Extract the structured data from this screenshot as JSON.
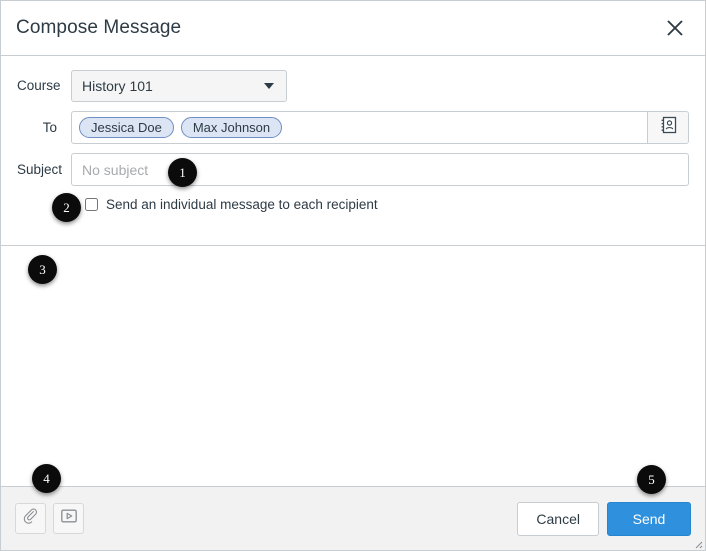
{
  "dialog": {
    "title": "Compose Message",
    "close_icon": "close-icon"
  },
  "form": {
    "course": {
      "label": "Course",
      "selected": "History 101",
      "caret_icon": "chevron-down-icon"
    },
    "to": {
      "label": "To",
      "recipients": [
        "Jessica Doe",
        "Max Johnson"
      ],
      "address_book_icon": "address-book-icon"
    },
    "subject": {
      "label": "Subject",
      "value": "",
      "placeholder": "No subject"
    },
    "individual_message": {
      "label": "Send an individual message to each recipient",
      "checked": false
    }
  },
  "body": {
    "value": "",
    "placeholder": ""
  },
  "footer": {
    "attach_icon": "paperclip-icon",
    "media_icon": "media-comment-icon",
    "cancel_label": "Cancel",
    "send_label": "Send",
    "resize_icon": "resize-grip-icon"
  },
  "annotations": [
    {
      "number": "1"
    },
    {
      "number": "2"
    },
    {
      "number": "3"
    },
    {
      "number": "4"
    },
    {
      "number": "5"
    }
  ],
  "colors": {
    "send_button": "#2f91de",
    "token_fill": "#dce5f4",
    "token_border": "#6f8ec4",
    "border": "#c7cdd1",
    "footer_bg": "#f2f2f2",
    "badge_bg": "#0b0b0b",
    "text": "#2d3b45"
  }
}
